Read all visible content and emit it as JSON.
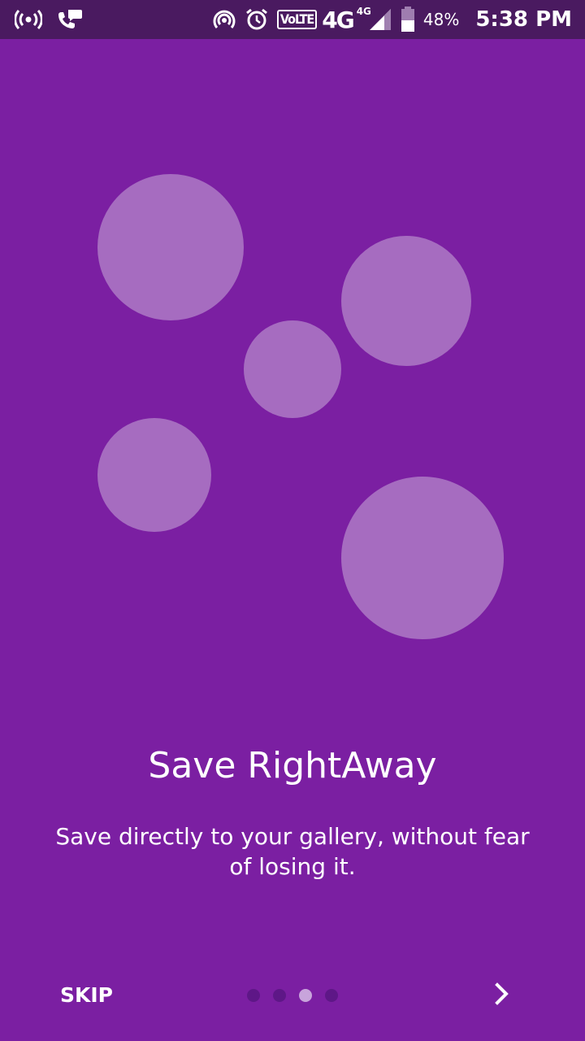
{
  "status_bar": {
    "left_icons": [
      "hotspot-broadcast-icon",
      "wifi-calling-icon"
    ],
    "right_icons": [
      "portable-hotspot-icon",
      "alarm-icon",
      "signal-icon",
      "battery-icon"
    ],
    "volte": "VoLTE",
    "network": "4G",
    "network_sup": "4G",
    "battery": "48%",
    "time": "5:38 PM"
  },
  "onboarding": {
    "title": "Save RightAway",
    "description": "Save directly to your gallery, without fear of losing it.",
    "skip_label": "SKIP",
    "page_indicator": {
      "count": 4,
      "current": 3
    },
    "next_icon": "chevron-right-icon"
  },
  "colors": {
    "background": "#7b1fa2",
    "status_bar": "#4a1a60",
    "bubble": "#a66cc0",
    "dot_inactive": "#5e1787",
    "dot_active": "#c8a4db",
    "text": "#ffffff"
  }
}
